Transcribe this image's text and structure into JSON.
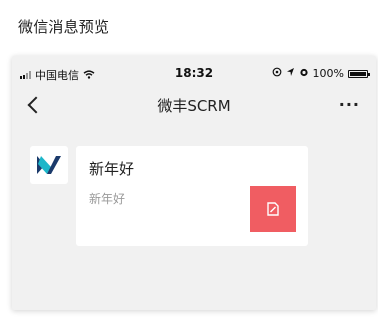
{
  "panel": {
    "title": "微信消息预览"
  },
  "statusbar": {
    "carrier": "中国电信",
    "time": "18:32",
    "battery": "100%"
  },
  "navbar": {
    "title": "微丰SCRM",
    "more": "···"
  },
  "message": {
    "title": "新年好",
    "description": "新年好",
    "thumbnail_color": "#f05d62",
    "thumbnail_icon": "link-icon"
  },
  "colors": {
    "logo_primary": "#1b3a6b",
    "logo_accent": "#1cb6c9"
  }
}
